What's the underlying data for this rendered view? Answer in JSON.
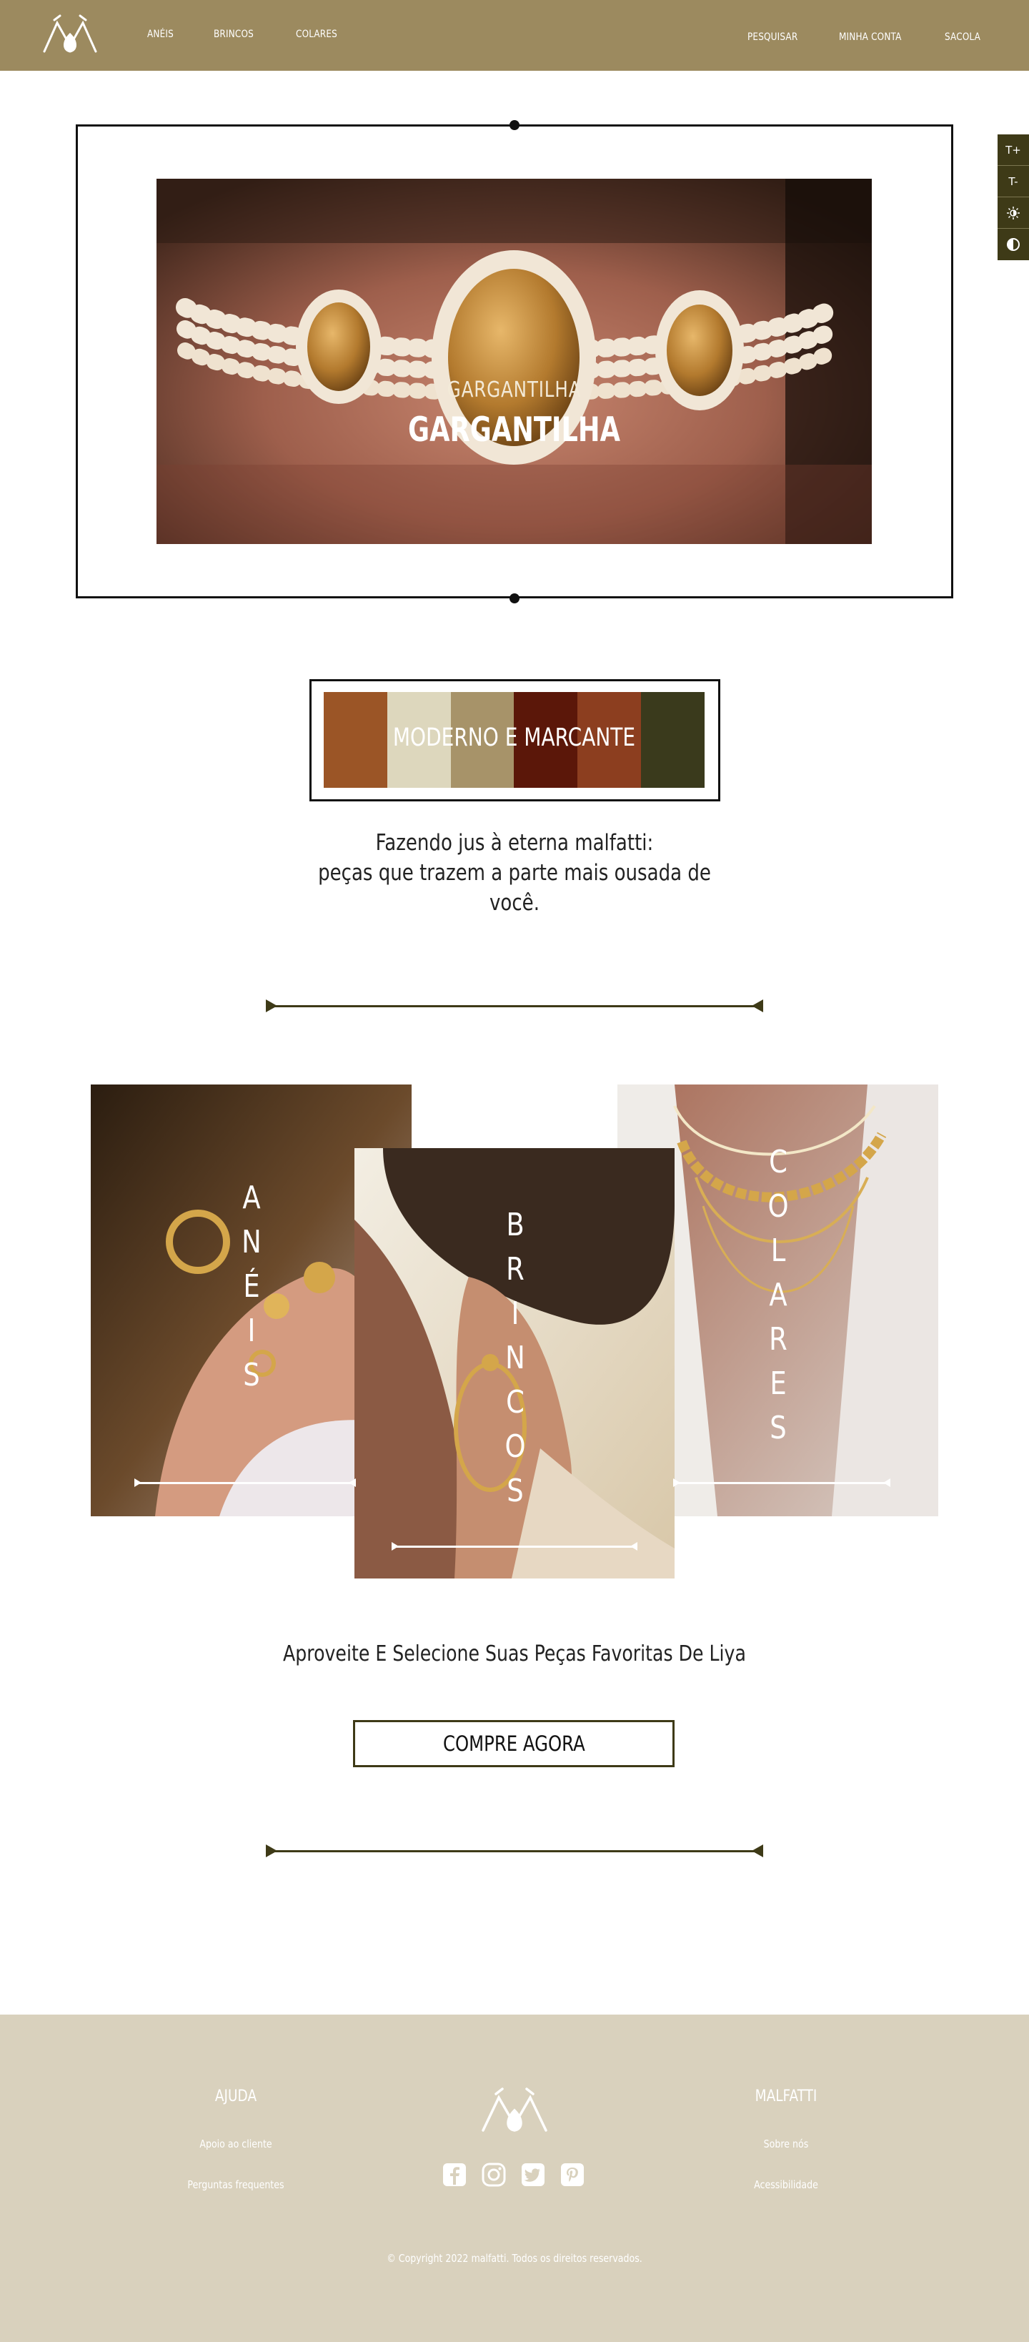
{
  "header": {
    "nav_left": [
      "ANÉIS",
      "BRINCOS",
      "COLARES"
    ],
    "nav_right": [
      "PESQUISAR",
      "MINHA CONTA",
      "SACOLA"
    ]
  },
  "accessibility": {
    "increase_font": "T+",
    "decrease_font": "T-"
  },
  "hero": {
    "subtitle": "GARGANTILHA",
    "title": "GARGANTILHA"
  },
  "palette": {
    "label": "MODERNO E MARCANTE",
    "colors": [
      "#9b5526",
      "#ddd7bd",
      "#a79369",
      "#5b1709",
      "#8c3e1f",
      "#3a3a1c"
    ]
  },
  "tagline": {
    "line1": "Fazendo jus à eterna malfatti:",
    "line2": "peças que trazem a parte mais ousada de",
    "line3": "você."
  },
  "categories": [
    {
      "title": "ANÉIS"
    },
    {
      "title": "BRINCOS"
    },
    {
      "title": "COLARES"
    }
  ],
  "cta": {
    "text": "Aproveite E Selecione Suas Peças Favoritas De Liya",
    "button": "COMPRE AGORA"
  },
  "footer": {
    "help_heading": "AJUDA",
    "help_links": [
      "Apoio ao cliente",
      "Perguntas frequentes"
    ],
    "brand_heading": "MALFATTI",
    "brand_links": [
      "Sobre nós",
      "Acessibilidade"
    ],
    "socials": [
      "facebook-icon",
      "instagram-icon",
      "twitter-icon",
      "pinterest-icon"
    ],
    "copyright": "© Copyright 2022 malfatti. Todos os direitos reservados."
  },
  "colors": {
    "header_bg": "#9c8a5f",
    "footer_bg": "#d9d1bd",
    "accent_dark": "#3e3a17"
  }
}
